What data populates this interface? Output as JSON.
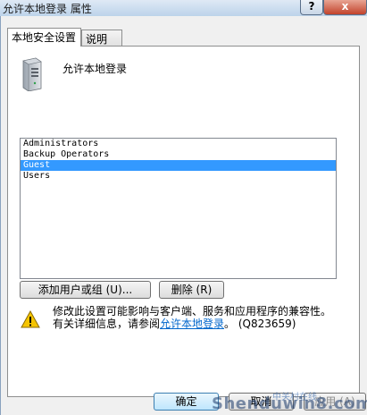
{
  "window": {
    "title": "允许本地登录 属性",
    "help_glyph": "?",
    "close_glyph": "x"
  },
  "tabs": [
    {
      "label": "本地安全设置",
      "active": true
    },
    {
      "label": "说明",
      "active": false
    }
  ],
  "policy": {
    "name": "允许本地登录",
    "icon": "server-icon"
  },
  "members": {
    "items": [
      "Administrators",
      "Backup Operators",
      "Guest",
      "Users"
    ],
    "selected_index": 2
  },
  "buttons": {
    "add": "添加用户或组 (U)...",
    "remove": "删除 (R)",
    "ok": "确定",
    "cancel": "取消",
    "apply": "应用 (A)"
  },
  "warning": {
    "icon": "warning-icon",
    "line1": "修改此设置可能影响与客户端、服务和应用程序的兼容性。",
    "line2_prefix": "有关详细信息，请参阅",
    "link": "允许本地登录",
    "line2_suffix": "。 (Q823659)"
  },
  "watermark": {
    "text": "Shenduwin8.com",
    "text_cn": "中关村在线"
  },
  "colors": {
    "selection": "#3399ff",
    "link": "#0066cc",
    "title_bar": "#c9dcef",
    "close_button": "#c2432b"
  }
}
